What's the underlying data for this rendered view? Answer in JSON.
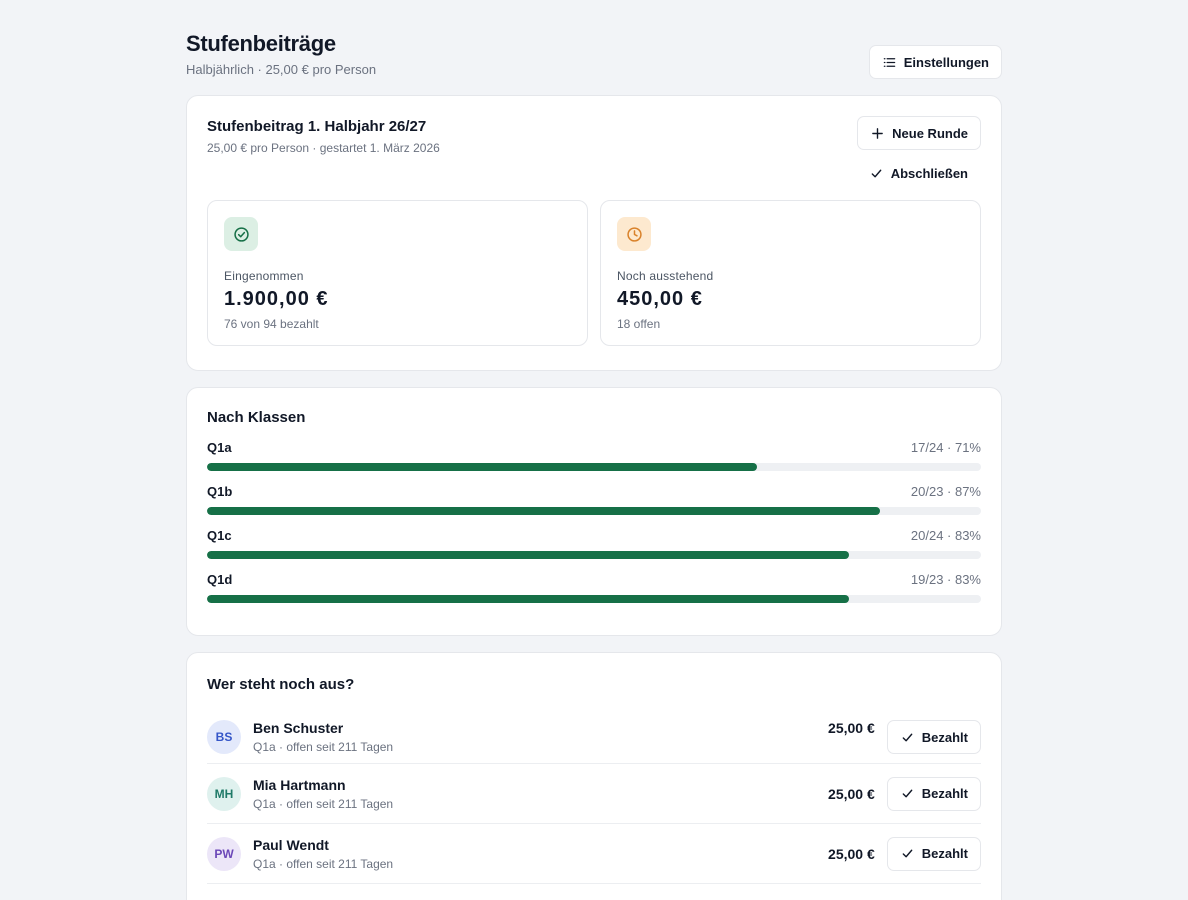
{
  "header": {
    "title": "Stufenbeiträge",
    "subtitle": "Halbjährlich · 25,00 € pro Person",
    "settings_label": "Einstellungen"
  },
  "round": {
    "title": "Stufenbeitrag 1. Halbjahr 26/27",
    "subtitle": "25,00 € pro Person · gestartet 1. März 2026",
    "new_round_label": "Neue Runde",
    "close_label": "Abschließen",
    "stats": {
      "received": {
        "label": "Eingenommen",
        "value": "1.900,00 €",
        "note": "76 von 94 bezahlt",
        "icon": "check-circle-icon",
        "color": "#167047"
      },
      "outstanding": {
        "label": "Noch ausstehend",
        "value": "450,00 €",
        "note": "18 offen",
        "icon": "clock-icon",
        "color": "#d9822b"
      }
    }
  },
  "classes": {
    "title": "Nach Klassen",
    "bar_color": "#167047",
    "items": [
      {
        "name": "Q1a",
        "stat": "17/24 · 71%",
        "progress": 0.71
      },
      {
        "name": "Q1b",
        "stat": "20/23 · 87%",
        "progress": 0.87
      },
      {
        "name": "Q1c",
        "stat": "20/24 · 83%",
        "progress": 0.83
      },
      {
        "name": "Q1d",
        "stat": "19/23 · 83%",
        "progress": 0.83
      }
    ]
  },
  "pending": {
    "title": "Wer steht noch aus?",
    "paid_label": "Bezahlt",
    "items": [
      {
        "initials": "BS",
        "name": "Ben Schuster",
        "meta": "Q1a · offen seit 211 Tagen",
        "amount": "25,00 €",
        "avatar_bg": "#e3e9fb",
        "avatar_fg": "#3556c8"
      },
      {
        "initials": "MH",
        "name": "Mia Hartmann",
        "meta": "Q1a · offen seit 211 Tagen",
        "amount": "25,00 €",
        "avatar_bg": "#dff1ee",
        "avatar_fg": "#1f7a68"
      },
      {
        "initials": "PW",
        "name": "Paul Wendt",
        "meta": "Q1a · offen seit 211 Tagen",
        "amount": "25,00 €",
        "avatar_bg": "#ece6f8",
        "avatar_fg": "#6b47b8"
      }
    ]
  }
}
